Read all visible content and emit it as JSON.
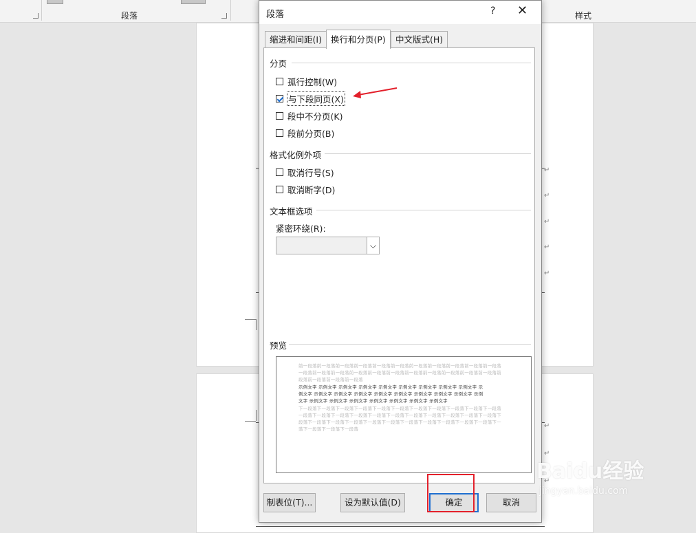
{
  "ribbon": {
    "group_paragraph": "段落",
    "group_styles": "样式"
  },
  "dialog": {
    "title": "段落",
    "help": "?",
    "close": "✕",
    "tabs": [
      {
        "label": "缩进和间距(I)"
      },
      {
        "label": "换行和分页(P)"
      },
      {
        "label": "中文版式(H)"
      }
    ],
    "pagination": {
      "heading": "分页",
      "options": [
        {
          "label": "孤行控制(W)",
          "checked": false
        },
        {
          "label": "与下段同页(X)",
          "checked": true
        },
        {
          "label": "段中不分页(K)",
          "checked": false
        },
        {
          "label": "段前分页(B)",
          "checked": false
        }
      ]
    },
    "formatting_exceptions": {
      "heading": "格式化例外项",
      "options": [
        {
          "label": "取消行号(S)",
          "checked": false
        },
        {
          "label": "取消断字(D)",
          "checked": false
        }
      ]
    },
    "textbox": {
      "heading": "文本框选项",
      "wrap_label": "紧密环绕(R):",
      "wrap_value": ""
    },
    "preview": {
      "heading": "预览",
      "prev_lines": [
        "前一段落前一段落前一段落前一段落前一段落前一段落前一段落前一段落前一段落前一段落前一段落",
        "一段落前一段落前一段落前一段落前一段落前一段落前一段落前一段落前一段落前一段落前一段落前",
        "段落前一段落前一段落前一段落"
      ],
      "sample_lines": [
        "示例文字 示例文字 示例文字 示例文字 示例文字 示例文字 示例文字 示例文字 示例文字 示",
        "例文字 示例文字 示例文字 示例文字 示例文字 示例文字 示例文字 示例文字 示例文字 示例",
        "文字 示例文字 示例文字 示例文字 示例文字 示例文字 示例文字 示例文字"
      ],
      "next_lines": [
        "下一段落下一段落下一段落下一段落下一段落下一段落下一段落下一段落下一段落下一段落下一段落",
        "一段落下一段落下一段落下一段落下一段落下一段落下一段落下一段落下一段落下一段落下一段落下",
        "段落下一段落下一段落下一段落下一段落下一段落下一段落下一段落下一段落下一段落下一段落下一",
        "落下一段落下一段落下一段落"
      ]
    },
    "buttons": {
      "tabs": "制表位(T)...",
      "set_default": "设为默认值(D)",
      "ok": "确定",
      "cancel": "取消"
    }
  },
  "watermark": {
    "brand": "Baidu经验",
    "url": "jingyan.baidu.com"
  },
  "colors": {
    "accent": "#1e6fd0",
    "annotation_red": "#e3202b"
  }
}
